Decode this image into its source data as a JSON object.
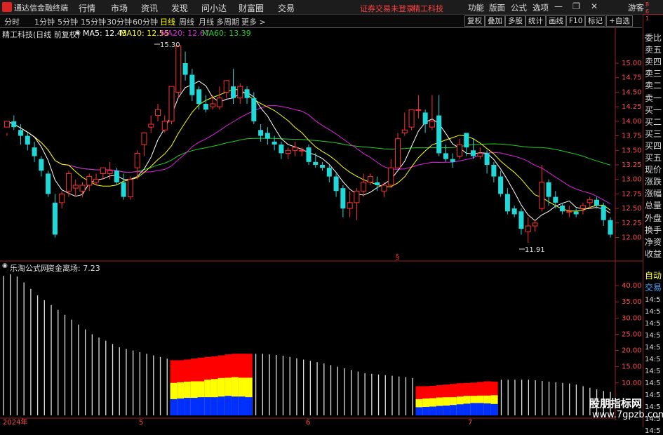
{
  "titlebar": {
    "app_name": "通达信金融终端",
    "menus": [
      "行情",
      "市场",
      "资讯",
      "发现",
      "问小达",
      "财富圈",
      "交易"
    ],
    "warning": "证券交易未登录",
    "stock_name": "精工科技",
    "tools": [
      "功能",
      "版面",
      "公式",
      "选项"
    ],
    "guest": "游客"
  },
  "periodbar": {
    "periods": [
      "分时",
      "1分钟",
      "5分钟",
      "15分钟",
      "30分钟",
      "60分钟",
      "日线",
      "周线",
      "月线",
      "多周期",
      "更多 >"
    ],
    "active": "日线",
    "right_buttons": [
      "复权",
      "叠加",
      "多股",
      "统计",
      "画线",
      "F10",
      "标记",
      "+自选"
    ]
  },
  "chart_header": {
    "title": "精工科技(日线 前复权)",
    "ma5": "MA5: 12.43",
    "ma10": "MA10: 12.55",
    "ma20": "MA20: 12.67",
    "ma60": "MA60: 13.39"
  },
  "colors": {
    "up": "#ff3030",
    "down": "#20d8d8",
    "ma5": "#ffffff",
    "ma10": "#ffff00",
    "ma20": "#e020e0",
    "ma60": "#20d020",
    "red": "#ff0000",
    "yellow": "#ffff00",
    "blue": "#0030ff"
  },
  "price_axis": {
    "ticks": [
      "15.00",
      "14.75",
      "14.50",
      "14.25",
      "14.00",
      "13.75",
      "13.50",
      "13.25",
      "13.00",
      "12.75",
      "12.50",
      "12.25",
      "12.00"
    ]
  },
  "annotations": {
    "high": "15.30",
    "low": "11.91",
    "marker": "§"
  },
  "indicator": {
    "source": "乐淘公式网",
    "name": "资金离场: 7.23",
    "ticks": [
      "40.00",
      "35.00",
      "30.00",
      "25.00",
      "20.00",
      "15.00",
      "10.00"
    ]
  },
  "xaxis": {
    "labels": [
      "2024年",
      "5",
      "6",
      "7"
    ]
  },
  "right_panel": {
    "items": [
      "委比",
      "卖五",
      "卖四",
      "卖三",
      "卖二",
      "卖一",
      "买一",
      "买二",
      "买三",
      "买四",
      "买五",
      "现价",
      "涨跌",
      "涨幅",
      "总量",
      "外盘",
      "换手",
      "净资",
      "收益"
    ],
    "auto": "自动",
    "trade": "交易",
    "times": [
      "14:5",
      "14:5",
      "14:5",
      "14:5",
      "14:5",
      "14:5",
      "14:5",
      "14:5",
      "14:5",
      "14:5",
      "14:5",
      "14:5"
    ],
    "side_digits": [
      "8",
      "6",
      "1"
    ]
  },
  "watermark": {
    "line1": "股朋指标网",
    "line2": "www.7gpzb.com"
  },
  "chart_data": [
    {
      "type": "candlestick",
      "title": "精工科技(日线 前复权)",
      "ylim": [
        11.85,
        15.35
      ],
      "candles": [
        [
          13.9,
          14.0,
          13.8,
          13.75
        ],
        [
          14.0,
          13.9,
          14.1,
          13.85
        ],
        [
          13.85,
          13.75,
          13.95,
          13.6
        ],
        [
          13.75,
          13.6,
          13.8,
          13.5
        ],
        [
          13.55,
          13.4,
          13.65,
          13.3
        ],
        [
          13.35,
          13.15,
          13.4,
          13.05
        ],
        [
          13.1,
          12.75,
          13.15,
          12.7
        ],
        [
          12.6,
          12.05,
          12.75,
          12.0
        ],
        [
          12.6,
          12.75,
          12.8,
          12.5
        ],
        [
          12.8,
          13.1,
          13.15,
          12.7
        ],
        [
          12.85,
          12.9,
          13.0,
          12.7
        ],
        [
          12.8,
          12.9,
          12.95,
          12.7
        ],
        [
          12.9,
          13.05,
          13.1,
          12.8
        ],
        [
          12.95,
          13.0,
          13.1,
          12.9
        ],
        [
          13.1,
          13.2,
          13.2,
          13.0
        ],
        [
          13.1,
          13.15,
          13.3,
          13.0
        ],
        [
          13.15,
          12.95,
          13.2,
          12.9
        ],
        [
          12.95,
          12.7,
          13.1,
          12.65
        ],
        [
          12.7,
          13.0,
          13.05,
          12.65
        ],
        [
          13.2,
          13.45,
          13.5,
          13.0
        ],
        [
          13.6,
          13.8,
          13.8,
          13.4
        ],
        [
          13.9,
          13.95,
          14.1,
          13.8
        ],
        [
          14.1,
          14.2,
          14.3,
          14.0
        ],
        [
          13.85,
          14.0,
          14.1,
          13.8
        ],
        [
          14.0,
          14.6,
          14.6,
          13.95
        ],
        [
          14.5,
          15.3,
          15.3,
          14.4
        ],
        [
          15.0,
          14.8,
          15.2,
          14.7
        ],
        [
          14.8,
          14.45,
          14.9,
          14.35
        ],
        [
          14.55,
          14.3,
          14.6,
          14.2
        ],
        [
          14.3,
          14.2,
          14.45,
          14.15
        ],
        [
          14.25,
          14.3,
          14.45,
          14.2
        ],
        [
          14.25,
          14.4,
          14.6,
          14.2
        ],
        [
          14.5,
          14.7,
          14.7,
          14.4
        ],
        [
          14.6,
          14.4,
          14.9,
          14.3
        ],
        [
          14.4,
          14.6,
          14.65,
          14.3
        ],
        [
          14.55,
          14.4,
          14.6,
          14.3
        ],
        [
          14.4,
          14.0,
          14.5,
          13.95
        ],
        [
          13.85,
          13.75,
          13.95,
          13.65
        ],
        [
          13.8,
          13.7,
          13.9,
          13.6
        ],
        [
          13.65,
          13.6,
          13.75,
          13.5
        ],
        [
          13.6,
          13.45,
          13.65,
          13.35
        ],
        [
          13.45,
          13.5,
          13.55,
          13.35
        ],
        [
          13.5,
          13.55,
          13.65,
          13.4
        ],
        [
          13.5,
          13.5,
          13.55,
          13.4
        ],
        [
          13.55,
          13.3,
          13.6,
          13.25
        ],
        [
          13.3,
          13.25,
          13.45,
          13.2
        ],
        [
          13.25,
          13.2,
          13.3,
          13.15
        ],
        [
          13.2,
          13.05,
          13.25,
          12.95
        ],
        [
          13.05,
          12.8,
          13.1,
          12.7
        ],
        [
          12.85,
          12.5,
          12.9,
          12.35
        ],
        [
          12.5,
          12.6,
          12.8,
          12.35
        ],
        [
          12.6,
          12.8,
          12.85,
          12.3
        ],
        [
          12.8,
          12.95,
          13.1,
          12.7
        ],
        [
          12.95,
          13.05,
          13.1,
          12.9
        ],
        [
          12.95,
          12.9,
          13.05,
          12.8
        ],
        [
          12.8,
          12.9,
          12.95,
          12.7
        ],
        [
          12.9,
          13.2,
          13.35,
          12.85
        ],
        [
          13.2,
          13.7,
          13.8,
          13.2
        ],
        [
          13.8,
          13.85,
          14.15,
          13.75
        ],
        [
          13.9,
          14.2,
          14.2,
          13.85
        ],
        [
          14.2,
          14.2,
          14.45,
          14.05
        ],
        [
          14.15,
          13.95,
          14.2,
          13.8
        ],
        [
          13.9,
          14.0,
          14.45,
          13.85
        ],
        [
          14.1,
          13.45,
          14.45,
          13.4
        ],
        [
          13.45,
          13.35,
          13.6,
          13.3
        ],
        [
          13.35,
          13.3,
          13.45,
          13.2
        ],
        [
          13.4,
          13.6,
          13.7,
          13.35
        ],
        [
          13.8,
          13.55,
          13.8,
          13.4
        ],
        [
          13.5,
          13.4,
          13.7,
          13.35
        ],
        [
          13.4,
          13.45,
          13.55,
          13.35
        ],
        [
          13.45,
          13.25,
          13.5,
          13.1
        ],
        [
          13.25,
          13.05,
          13.3,
          12.95
        ],
        [
          13.05,
          12.75,
          13.15,
          12.7
        ],
        [
          12.75,
          12.45,
          12.85,
          12.4
        ],
        [
          12.5,
          12.4,
          12.55,
          12.35
        ],
        [
          12.45,
          12.15,
          12.5,
          12.05
        ],
        [
          12.1,
          12.2,
          12.35,
          11.91
        ],
        [
          12.2,
          12.25,
          12.3,
          12.1
        ],
        [
          12.5,
          12.95,
          13.25,
          12.45
        ],
        [
          12.95,
          12.7,
          13.0,
          12.55
        ],
        [
          12.7,
          12.6,
          12.8,
          12.5
        ],
        [
          12.55,
          12.45,
          12.6,
          12.4
        ],
        [
          12.45,
          12.45,
          12.55,
          12.35
        ],
        [
          12.45,
          12.4,
          12.5,
          12.35
        ],
        [
          12.5,
          12.55,
          12.6,
          12.4
        ],
        [
          12.6,
          12.65,
          12.7,
          12.5
        ],
        [
          12.65,
          12.55,
          12.7,
          12.5
        ],
        [
          12.55,
          12.3,
          12.6,
          12.2
        ],
        [
          12.3,
          12.05,
          12.35,
          12.0
        ]
      ]
    },
    {
      "type": "bar",
      "title": "资金离场: 7.23",
      "ylim": [
        0,
        45
      ],
      "white": [
        43.0,
        43.5,
        42.8,
        41.0,
        39.0,
        37.0,
        35.5,
        34.0,
        32.5,
        31.0,
        29.5,
        28.0,
        26.5,
        25.0,
        24.0,
        23.0,
        22.0,
        21.0,
        20.5,
        20.0,
        19.5,
        19.0,
        18.5,
        18.0,
        17.5,
        0,
        0,
        0,
        0,
        0,
        0,
        0,
        0,
        0,
        0,
        0,
        0,
        19.0,
        19.0,
        18.8,
        18.6,
        18.4,
        18.0,
        17.6,
        17.2,
        16.8,
        16.4,
        16.0,
        15.5,
        15.0,
        14.5,
        14.0,
        13.5,
        13.0,
        12.8,
        12.6,
        12.4,
        12.2,
        12.0,
        11.8,
        11.5,
        0,
        0,
        0,
        0,
        0,
        0,
        0,
        0,
        0,
        0,
        0,
        0,
        11.0,
        11.0,
        11.0,
        11.0,
        11.0,
        10.8,
        10.6,
        10.4,
        10.2,
        10.0,
        9.8,
        9.5,
        9.0,
        8.5,
        8.0,
        7.5,
        7.23
      ],
      "stacked_red": [
        17,
        17,
        17.2,
        17.5,
        17.8,
        18,
        18.2,
        18.5,
        18.8,
        19,
        19,
        19,
        9,
        9,
        9.1,
        9.3,
        9.5,
        9.7,
        9.9,
        10,
        10.1,
        10.3,
        10.5,
        10.4
      ],
      "stacked_yellow": [
        10,
        10.2,
        10.4,
        10.5,
        10.5,
        11,
        11.2,
        11.5,
        11.6,
        11.8,
        11.6,
        11.6,
        5,
        5.2,
        5.3,
        5.5,
        5.6,
        5.6,
        5.8,
        6.0,
        6.0,
        6.1,
        6.1,
        6.2
      ],
      "stacked_blue": [
        5,
        5.2,
        5.4,
        5.4,
        5.6,
        5.6,
        5.6,
        5.8,
        6.0,
        5.8,
        5.8,
        5.6,
        2.5,
        2.6,
        2.7,
        2.9,
        3.0,
        3.2,
        3.4,
        3.6,
        3.8,
        3.8,
        3.7,
        3.5
      ]
    }
  ]
}
